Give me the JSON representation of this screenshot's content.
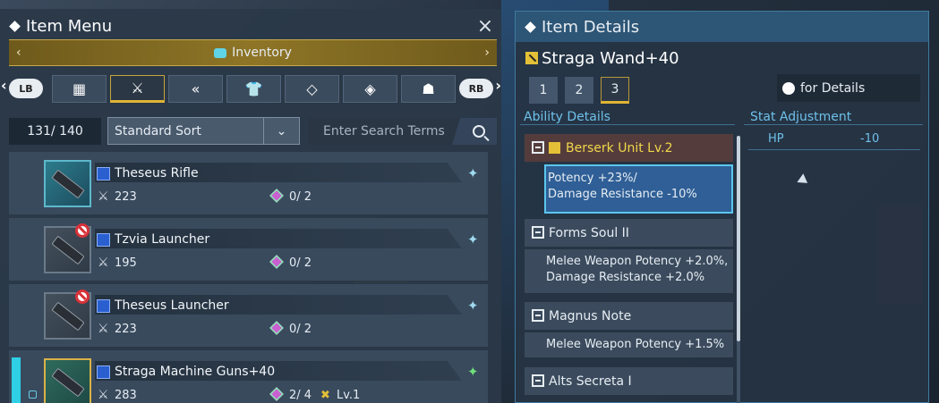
{
  "item_menu": {
    "title": "Item Menu",
    "close_label": "×",
    "inventory_label": "Inventory",
    "lb_label": "LB",
    "rb_label": "RB",
    "count": "131/ 140",
    "sort": {
      "value": "Standard Sort"
    },
    "search": {
      "placeholder": "Enter Search Terms"
    },
    "category_tabs": [
      {
        "icon": "grid-icon"
      },
      {
        "icon": "sword-icon",
        "active": true
      },
      {
        "icon": "double-chevron-icon"
      },
      {
        "icon": "shirt-icon"
      },
      {
        "icon": "tag-icon"
      },
      {
        "icon": "gem-icon"
      },
      {
        "icon": "bag-icon"
      }
    ],
    "items": [
      {
        "name": "Theseus Rifle",
        "attack": "223",
        "slots": "0/ 2",
        "restricted": false,
        "favorite_color": "#9fd9ef"
      },
      {
        "name": "Tzvia Launcher",
        "attack": "195",
        "slots": "0/ 2",
        "restricted": true,
        "favorite_color": "#9fd9ef"
      },
      {
        "name": "Theseus Launcher",
        "attack": "223",
        "slots": "0/ 2",
        "restricted": true,
        "favorite_color": "#9fd9ef"
      },
      {
        "name": "Straga Machine Guns+40",
        "attack": "283",
        "slots": "2/ 4",
        "level": "Lv.1",
        "restricted": false,
        "favorite_color": "#6fe07a"
      }
    ]
  },
  "item_details": {
    "title": "Item Details",
    "item_name": "Straga Wand+40",
    "number_tabs": [
      "1",
      "2",
      "3"
    ],
    "active_tab": "3",
    "details_button": "for Details",
    "ability_header": "Ability Details",
    "stat_header": "Stat Adjustment",
    "abilities": [
      {
        "name": "Berserk Unit Lv.2",
        "desc_line1": "Potency +23%/",
        "desc_line2": "Damage Resistance -10%"
      },
      {
        "name": "Forms Soul II",
        "desc_line1": "Melee Weapon Potency +2.0%,",
        "desc_line2": "Damage Resistance +2.0%"
      },
      {
        "name": "Magnus Note",
        "desc_line1": "Melee Weapon Potency +1.5%"
      },
      {
        "name": "Alts Secreta I"
      }
    ],
    "stats": [
      {
        "label": "HP",
        "value": "-10"
      }
    ]
  }
}
